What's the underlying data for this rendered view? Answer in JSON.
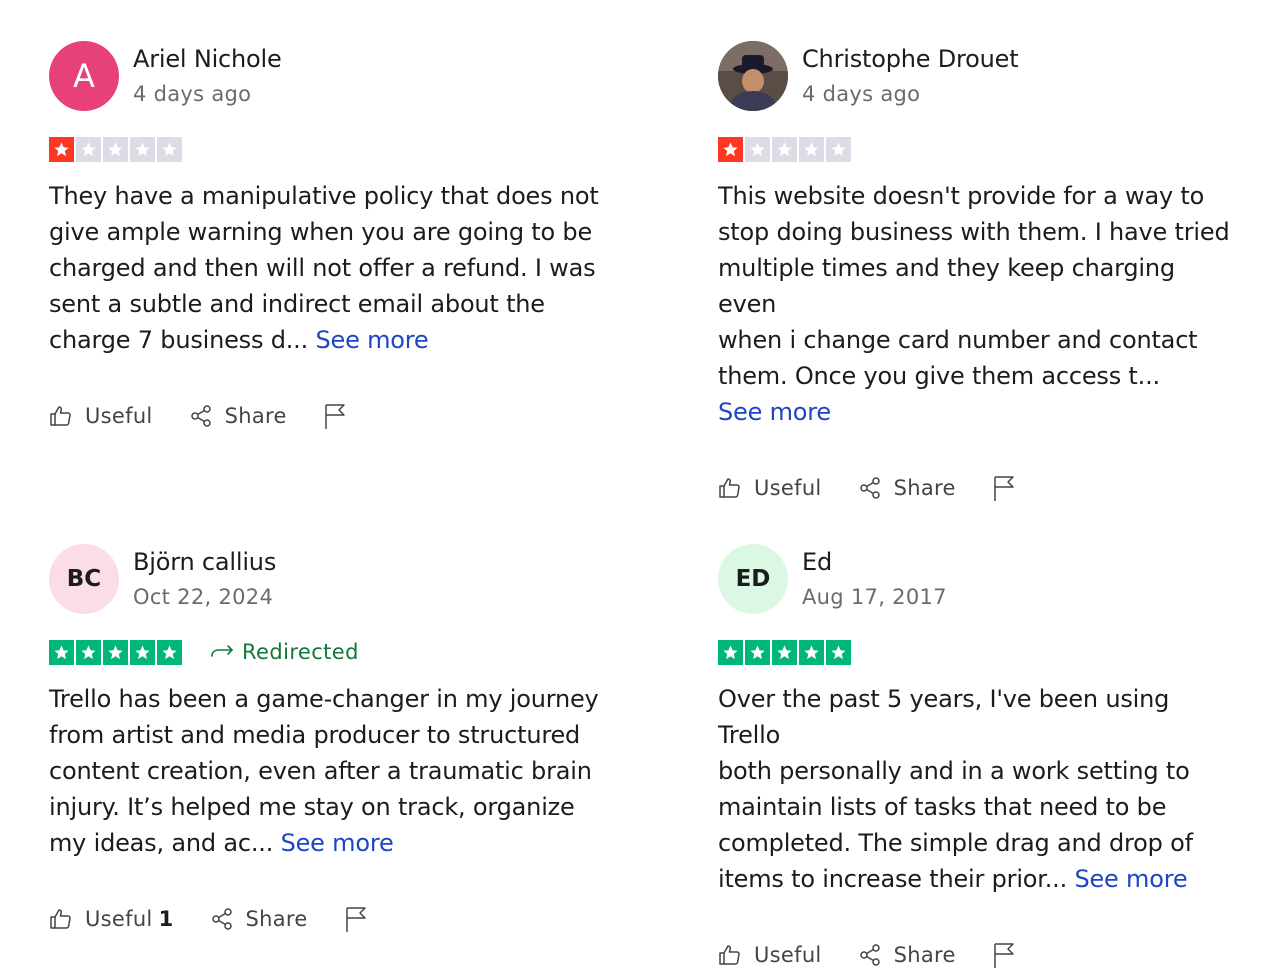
{
  "reviews": [
    {
      "name": "Ariel Nichole",
      "date": "4 days ago",
      "avatar_initials": "A",
      "avatar_color": "#e8407a",
      "rating": 1,
      "text": "They have a manipulative policy that does not\ngive ample warning when you are going to be\ncharged and then will not offer a refund. I was\nsent a subtle and indirect email about the\ncharge 7 business d... ",
      "see_more": "See more",
      "useful_label": "Useful",
      "share_label": "Share"
    },
    {
      "name": "Christophe Drouet",
      "date": "4 days ago",
      "avatar_type": "photo",
      "rating": 1,
      "text": "This website doesn't provide for a way to\nstop doing business with them. I have tried\nmultiple times and they keep charging even\nwhen i change card number and contact\nthem. Once you give them access t...\n",
      "see_more": "See more",
      "useful_label": "Useful",
      "share_label": "Share"
    },
    {
      "name": "Björn callius",
      "date": "Oct 22, 2024",
      "avatar_initials": "BC",
      "avatar_color": "#fbdde6",
      "rating": 5,
      "redirected_label": "Redirected",
      "text": "Trello has been a game-changer in my journey\nfrom artist and media producer to structured\ncontent creation, even after a traumatic brain\ninjury. It’s helped me stay on track, organize\nmy ideas, and ac... ",
      "see_more": "See more",
      "useful_label": "Useful",
      "useful_count": "1",
      "share_label": "Share"
    },
    {
      "name": "Ed",
      "date": "Aug 17, 2017",
      "avatar_initials": "ED",
      "avatar_color": "#dbf8e4",
      "rating": 5,
      "text": "Over the past 5 years, I've been using Trello\nboth personally and in a work setting to\nmaintain lists of tasks that need to be\ncompleted. The simple drag and drop of\nitems to increase their prior... ",
      "see_more": "See more",
      "useful_label": "Useful",
      "share_label": "Share"
    }
  ],
  "colors": {
    "star_low": "#ff3722",
    "star_high": "#00b67a",
    "star_empty": "#dcdce6",
    "link": "#1e45c4",
    "redirected": "#12783a"
  }
}
